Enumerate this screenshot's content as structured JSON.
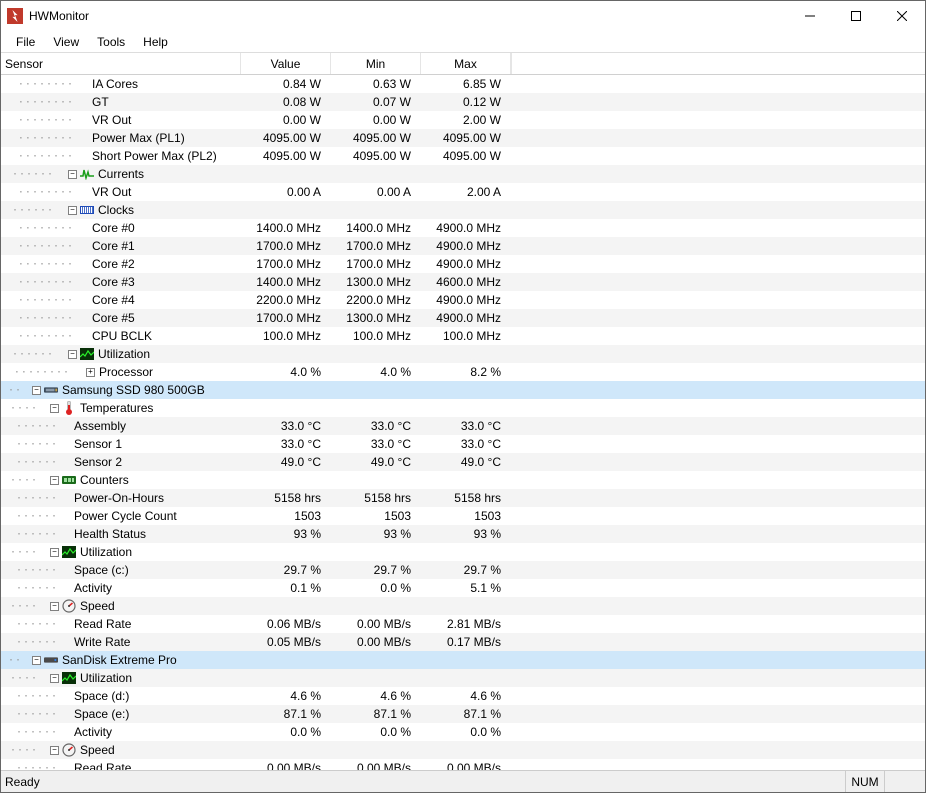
{
  "app": {
    "title": "HWMonitor"
  },
  "menu": [
    "File",
    "View",
    "Tools",
    "Help"
  ],
  "columns": {
    "sensor": "Sensor",
    "value": "Value",
    "min": "Min",
    "max": "Max"
  },
  "status": {
    "ready": "Ready",
    "num": "NUM"
  },
  "icons": {
    "currents": "currents-icon",
    "clocks": "clocks-icon",
    "utilization": "utilization-icon",
    "ssd": "ssd-icon",
    "temperatures": "thermometer-icon",
    "counters": "counters-icon",
    "speed": "gauge-icon",
    "hdd": "hdd-icon"
  },
  "rows": [
    {
      "depth": 5,
      "label": "IA Cores",
      "v": "0.84 W",
      "min": "0.63 W",
      "max": "6.85 W"
    },
    {
      "depth": 5,
      "label": "GT",
      "v": "0.08 W",
      "min": "0.07 W",
      "max": "0.12 W"
    },
    {
      "depth": 5,
      "label": "VR Out",
      "v": "0.00 W",
      "min": "0.00 W",
      "max": "2.00 W"
    },
    {
      "depth": 5,
      "label": "Power Max (PL1)",
      "v": "4095.00 W",
      "min": "4095.00 W",
      "max": "4095.00 W"
    },
    {
      "depth": 5,
      "label": "Short Power Max (PL2)",
      "v": "4095.00 W",
      "min": "4095.00 W",
      "max": "4095.00 W"
    },
    {
      "depth": 4,
      "group": true,
      "exp": "-",
      "icon": "currents",
      "label": "Currents"
    },
    {
      "depth": 5,
      "label": "VR Out",
      "v": "0.00 A",
      "min": "0.00 A",
      "max": "2.00 A"
    },
    {
      "depth": 4,
      "group": true,
      "exp": "-",
      "icon": "clocks",
      "label": "Clocks"
    },
    {
      "depth": 5,
      "label": "Core #0",
      "v": "1400.0 MHz",
      "min": "1400.0 MHz",
      "max": "4900.0 MHz"
    },
    {
      "depth": 5,
      "label": "Core #1",
      "v": "1700.0 MHz",
      "min": "1700.0 MHz",
      "max": "4900.0 MHz"
    },
    {
      "depth": 5,
      "label": "Core #2",
      "v": "1700.0 MHz",
      "min": "1700.0 MHz",
      "max": "4900.0 MHz"
    },
    {
      "depth": 5,
      "label": "Core #3",
      "v": "1400.0 MHz",
      "min": "1300.0 MHz",
      "max": "4600.0 MHz"
    },
    {
      "depth": 5,
      "label": "Core #4",
      "v": "2200.0 MHz",
      "min": "2200.0 MHz",
      "max": "4900.0 MHz"
    },
    {
      "depth": 5,
      "label": "Core #5",
      "v": "1700.0 MHz",
      "min": "1300.0 MHz",
      "max": "4900.0 MHz"
    },
    {
      "depth": 5,
      "label": "CPU BCLK",
      "v": "100.0 MHz",
      "min": "100.0 MHz",
      "max": "100.0 MHz"
    },
    {
      "depth": 4,
      "group": true,
      "exp": "-",
      "icon": "utilization",
      "label": "Utilization"
    },
    {
      "depth": 5,
      "exp": "+",
      "label": "Processor",
      "v": "4.0 %",
      "min": "4.0 %",
      "max": "8.2 %"
    },
    {
      "depth": 2,
      "device": true,
      "exp": "-",
      "icon": "ssd",
      "label": "Samsung SSD 980 500GB"
    },
    {
      "depth": 3,
      "group": true,
      "exp": "-",
      "icon": "temperatures",
      "label": "Temperatures"
    },
    {
      "depth": 4,
      "label": "Assembly",
      "v": "33.0 °C",
      "min": "33.0 °C",
      "max": "33.0 °C"
    },
    {
      "depth": 4,
      "label": "Sensor 1",
      "v": "33.0 °C",
      "min": "33.0 °C",
      "max": "33.0 °C"
    },
    {
      "depth": 4,
      "label": "Sensor 2",
      "v": "49.0 °C",
      "min": "49.0 °C",
      "max": "49.0 °C"
    },
    {
      "depth": 3,
      "group": true,
      "exp": "-",
      "icon": "counters",
      "label": "Counters"
    },
    {
      "depth": 4,
      "label": "Power-On-Hours",
      "v": "5158 hrs",
      "min": "5158 hrs",
      "max": "5158 hrs"
    },
    {
      "depth": 4,
      "label": "Power Cycle Count",
      "v": "1503",
      "min": "1503",
      "max": "1503"
    },
    {
      "depth": 4,
      "label": "Health Status",
      "v": "93 %",
      "min": "93 %",
      "max": "93 %"
    },
    {
      "depth": 3,
      "group": true,
      "exp": "-",
      "icon": "utilization",
      "label": "Utilization"
    },
    {
      "depth": 4,
      "label": "Space (c:)",
      "v": "29.7 %",
      "min": "29.7 %",
      "max": "29.7 %"
    },
    {
      "depth": 4,
      "label": "Activity",
      "v": "0.1 %",
      "min": "0.0 %",
      "max": "5.1 %"
    },
    {
      "depth": 3,
      "group": true,
      "exp": "-",
      "icon": "speed",
      "label": "Speed"
    },
    {
      "depth": 4,
      "label": "Read Rate",
      "v": "0.06 MB/s",
      "min": "0.00 MB/s",
      "max": "2.81 MB/s"
    },
    {
      "depth": 4,
      "label": "Write Rate",
      "v": "0.05 MB/s",
      "min": "0.00 MB/s",
      "max": "0.17 MB/s"
    },
    {
      "depth": 2,
      "device": true,
      "exp": "-",
      "icon": "hdd",
      "label": "SanDisk  Extreme Pro"
    },
    {
      "depth": 3,
      "group": true,
      "exp": "-",
      "icon": "utilization",
      "label": "Utilization"
    },
    {
      "depth": 4,
      "label": "Space (d:)",
      "v": "4.6 %",
      "min": "4.6 %",
      "max": "4.6 %"
    },
    {
      "depth": 4,
      "label": "Space (e:)",
      "v": "87.1 %",
      "min": "87.1 %",
      "max": "87.1 %"
    },
    {
      "depth": 4,
      "label": "Activity",
      "v": "0.0 %",
      "min": "0.0 %",
      "max": "0.0 %"
    },
    {
      "depth": 3,
      "group": true,
      "exp": "-",
      "icon": "speed",
      "label": "Speed"
    },
    {
      "depth": 4,
      "label": "Read Rate",
      "v": "0.00 MB/s",
      "min": "0.00 MB/s",
      "max": "0.00 MB/s"
    }
  ]
}
